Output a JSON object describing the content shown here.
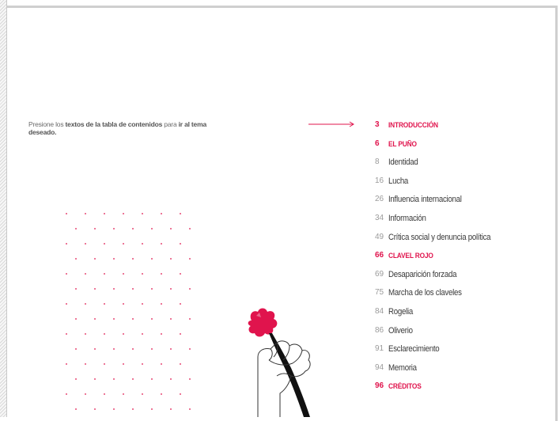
{
  "instruction": {
    "part1": "Presione los ",
    "part2": "textos de la tabla de contenidos",
    "part3": " para ",
    "part4": "ir al tema deseado."
  },
  "toc": [
    {
      "page": "3",
      "title": "INTRODUCCIÓN",
      "type": "section"
    },
    {
      "page": "6",
      "title": "EL PUÑO",
      "type": "section"
    },
    {
      "page": "8",
      "title": "Identidad",
      "type": "item"
    },
    {
      "page": "16",
      "title": "Lucha",
      "type": "item"
    },
    {
      "page": "26",
      "title": "Influencia internacional",
      "type": "item"
    },
    {
      "page": "34",
      "title": "Información",
      "type": "item"
    },
    {
      "page": "49",
      "title": "Crítica social y denuncia política",
      "type": "item"
    },
    {
      "page": "66",
      "title": "CLAVEL ROJO",
      "type": "section"
    },
    {
      "page": "69",
      "title": "Desaparición forzada",
      "type": "item"
    },
    {
      "page": "75",
      "title": "Marcha de los claveles",
      "type": "item"
    },
    {
      "page": "84",
      "title": "Rogelia",
      "type": "item"
    },
    {
      "page": "86",
      "title": "Oliverio",
      "type": "item"
    },
    {
      "page": "91",
      "title": "Esclarecimiento",
      "type": "item"
    },
    {
      "page": "94",
      "title": "Memoria",
      "type": "item"
    },
    {
      "page": "96",
      "title": "CRÉDITOS",
      "type": "section"
    }
  ],
  "colors": {
    "accent": "#e0144d",
    "text": "#3a3a3a",
    "muted": "#9a9a9a"
  },
  "icons": {
    "arrow": "arrow-right-icon",
    "illustration": "raised-fist-carnation-icon",
    "pattern": "dot-grid-pattern"
  }
}
